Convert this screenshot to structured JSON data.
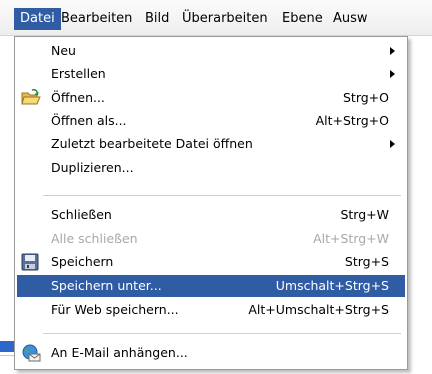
{
  "menubar": {
    "items": [
      {
        "label": "Datei",
        "active": true
      },
      {
        "label": "Bearbeiten"
      },
      {
        "label": "Bild"
      },
      {
        "label": "Überarbeiten"
      },
      {
        "label": "Ebene"
      },
      {
        "label": "Ausw"
      }
    ]
  },
  "menu": {
    "items": [
      {
        "label": "Neu",
        "shortcut": "",
        "submenu": true
      },
      {
        "label": "Erstellen",
        "shortcut": "",
        "submenu": true
      },
      {
        "label": "Öffnen...",
        "shortcut": "Strg+O",
        "icon": "folder-open-icon"
      },
      {
        "label": "Öffnen als...",
        "shortcut": "Alt+Strg+O"
      },
      {
        "label": "Zuletzt bearbeitete Datei öffnen",
        "shortcut": "",
        "submenu": true
      },
      {
        "label": "Duplizieren...",
        "shortcut": ""
      },
      {
        "label": "Schließen",
        "shortcut": "Strg+W"
      },
      {
        "label": "Alle schließen",
        "shortcut": "Alt+Strg+W",
        "disabled": true
      },
      {
        "label": "Speichern",
        "shortcut": "Strg+S",
        "icon": "floppy-disk-icon"
      },
      {
        "label": "Speichern unter...",
        "shortcut": "Umschalt+Strg+S",
        "highlighted": true
      },
      {
        "label": "Für Web speichern...",
        "shortcut": "Alt+Umschalt+Strg+S"
      },
      {
        "label": "An E-Mail anhängen...",
        "shortcut": "",
        "icon": "email-globe-icon"
      }
    ]
  },
  "colors": {
    "highlight": "#2f5ca3",
    "disabled_text": "#a8a8a8"
  }
}
